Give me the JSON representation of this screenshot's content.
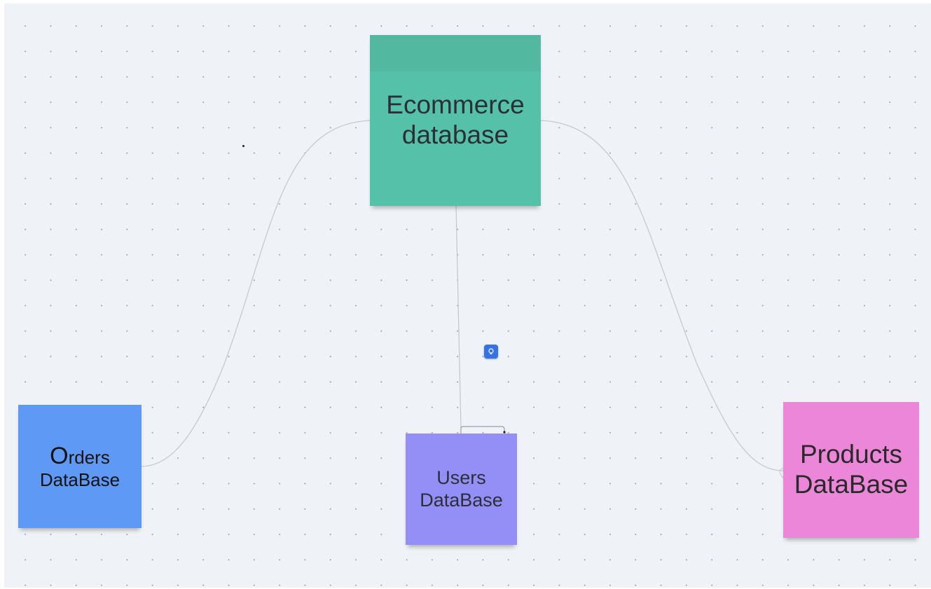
{
  "board": {
    "background_color": "#eff2f6",
    "grid_dot_color": "#9aa1ab"
  },
  "notes": {
    "ecommerce": {
      "line1": "Ecommerce",
      "line2": "database",
      "color": "#56c1a9"
    },
    "orders": {
      "initial": "O",
      "line1_rest": "rders",
      "line2": "DataBase",
      "color": "#5d99f5"
    },
    "users": {
      "line1": "Users",
      "line2": "DataBase",
      "color": "#938ff7"
    },
    "products": {
      "line1": "Products",
      "line2": "DataBase",
      "color": "#ec86d8"
    }
  },
  "connectors": {
    "color": "#c6c9ce",
    "links": [
      {
        "from": "Ecommerce database",
        "to": "Orders DataBase",
        "style": "curved"
      },
      {
        "from": "Ecommerce database",
        "to": "Users DataBase",
        "style": "straight"
      },
      {
        "from": "Ecommerce database",
        "to": "Products DataBase",
        "style": "curved"
      }
    ]
  },
  "tools": {
    "idea_button": {
      "icon": "lightbulb-icon",
      "color": "#3472e6"
    }
  }
}
